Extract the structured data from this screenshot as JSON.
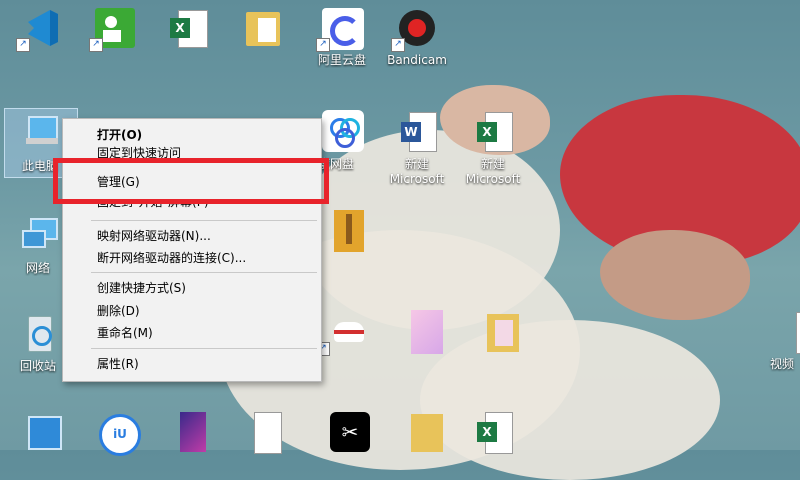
{
  "desktop": {
    "icons": [
      {
        "label": "",
        "icon": "vscode-icon"
      },
      {
        "label": "",
        "icon": "green-app-icon"
      },
      {
        "label": "",
        "icon": "excel-icon"
      },
      {
        "label": "",
        "icon": "folder-icon"
      },
      {
        "label": "阿里云盘",
        "icon": "aliyun-drive-icon"
      },
      {
        "label": "Bandicam",
        "icon": "bandicam-icon"
      },
      {
        "label": "此电脑",
        "icon": "this-pc-icon"
      },
      {
        "label": "度网盘",
        "icon": "baidu-netdisk-icon"
      },
      {
        "label": "新建 Microsoft",
        "icon": "word-doc-icon"
      },
      {
        "label": "新建 Microsoft",
        "icon": "excel-doc-icon"
      },
      {
        "label": "网络",
        "icon": "network-icon"
      },
      {
        "label": "回收站",
        "icon": "recycle-bin-icon"
      },
      {
        "label": "视频",
        "icon": "video-folder-icon"
      }
    ]
  },
  "context_menu": {
    "items": [
      {
        "label": "打开(O)",
        "bold": true
      },
      {
        "label": "固定到快速访问"
      },
      {
        "label": "管理(G)"
      },
      {
        "label": "固定到\"开始\"屏幕(P)"
      },
      {
        "label": "映射网络驱动器(N)..."
      },
      {
        "label": "断开网络驱动器的连接(C)..."
      },
      {
        "label": "创建快捷方式(S)"
      },
      {
        "label": "删除(D)"
      },
      {
        "label": "重命名(M)"
      },
      {
        "label": "属性(R)"
      }
    ]
  },
  "colors": {
    "highlight_border": "#e8232b",
    "menu_bg": "#f2f2f2"
  }
}
